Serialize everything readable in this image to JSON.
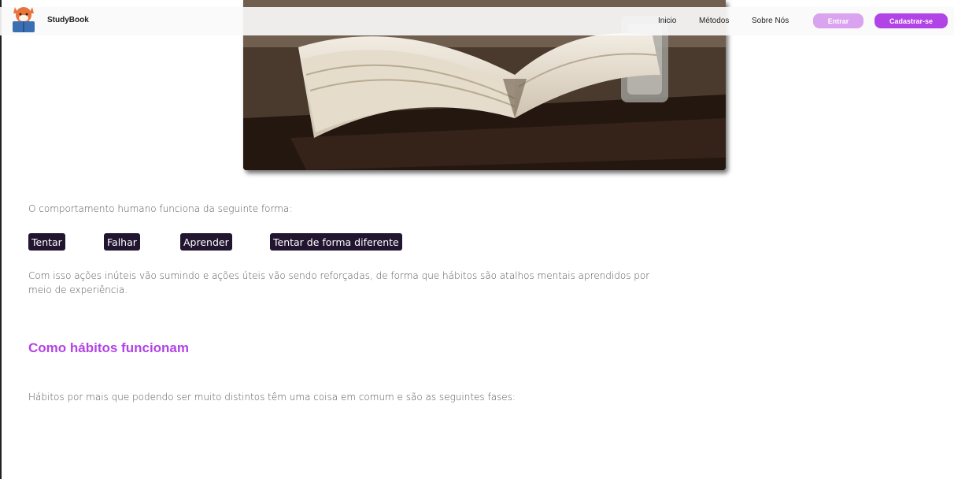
{
  "app": {
    "brand": "StudyBook"
  },
  "nav": {
    "links": [
      "Inicio",
      "Métodos",
      "Sobre Nós"
    ],
    "login_label": "Entrar",
    "signup_label": "Cadastrar-se"
  },
  "content": {
    "intro": "O comportamento humano funciona da seguinte forma:",
    "steps": [
      "Tentar",
      "Falhar",
      "Aprender",
      "Tentar de forma diferente"
    ],
    "paragraph": "Com isso ações inúteis vão sumindo e ações úteis vão sendo reforçadas, de forma que hábitos são atalhos mentais aprendidos por meio de experiência.",
    "section_title": "Como hábitos funcionam",
    "section_text": "Hábitos por mais que podendo ser muito distintos têm uma coisa em comum e são as seguintes fases:"
  },
  "colors": {
    "accent": "#b243e6",
    "accent_light": "#d9a3ef",
    "chip_bg": "#221530"
  },
  "icons": {
    "logo": "fox-reading-book-icon"
  }
}
